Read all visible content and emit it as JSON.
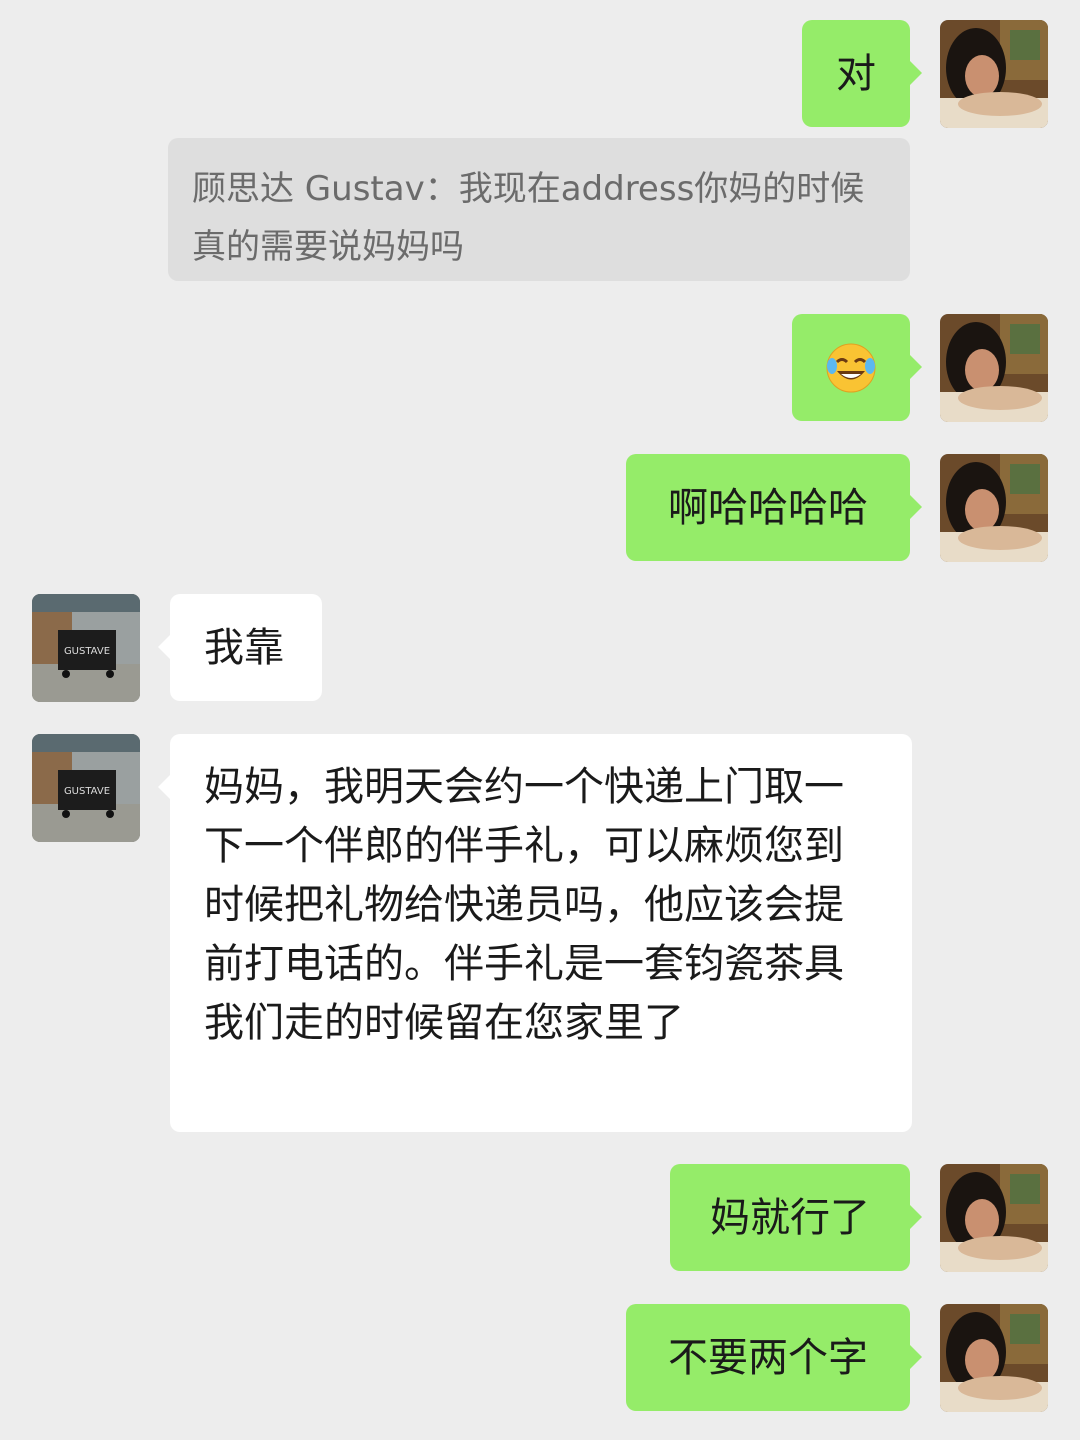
{
  "colors": {
    "background": "#ededed",
    "my_bubble": "#95ec69",
    "their_bubble": "#ffffff",
    "quote_bg": "#dedede"
  },
  "messages": [
    {
      "id": "m1",
      "sender": "me",
      "type": "text",
      "text": "对"
    },
    {
      "id": "q1",
      "type": "quote",
      "text": "顾思达 Gustav：我现在address你妈的时候真的需要说妈妈吗"
    },
    {
      "id": "m2",
      "sender": "me",
      "type": "emoji",
      "icon": "tears-of-joy-emoji-icon"
    },
    {
      "id": "m3",
      "sender": "me",
      "type": "text",
      "text": "啊哈哈哈哈"
    },
    {
      "id": "m4",
      "sender": "other",
      "type": "text",
      "text": "我靠"
    },
    {
      "id": "m5",
      "sender": "other",
      "type": "text",
      "text": "妈妈，我明天会约一个快递上门取一下一个伴郎的伴手礼，可以麻烦您到时候把礼物给快递员吗，他应该会提前打电话的。伴手礼是一套钧瓷茶具 我们走的时候留在您家里了"
    },
    {
      "id": "m6",
      "sender": "me",
      "type": "text",
      "text": "妈就行了"
    },
    {
      "id": "m7",
      "sender": "me",
      "type": "text",
      "text": "不要两个字"
    }
  ],
  "other_avatar": {
    "icon": "dumpster-photo-avatar-icon",
    "graffiti": "GUSTAVE"
  },
  "my_avatar": {
    "icon": "woman-portrait-avatar-icon"
  }
}
